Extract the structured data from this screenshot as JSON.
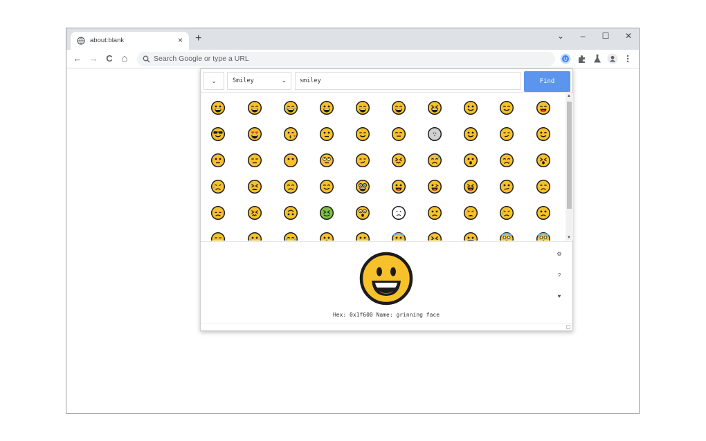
{
  "tab": {
    "title": "about:blank",
    "close": "×"
  },
  "new_tab": "+",
  "window": {
    "dropdown": "⌄",
    "minimize": "–",
    "maximize": "☐",
    "close": "✕"
  },
  "nav": {
    "back": "←",
    "forward": "→",
    "reload": "C",
    "home": "⌂"
  },
  "omnibox": {
    "placeholder": "Search Google or type a URL"
  },
  "popup": {
    "mode_label": "⌄",
    "category": "Smiley",
    "search_value": "smiley",
    "find_label": "Find",
    "emojis": [
      [
        "grinning",
        "grin-big",
        "joy",
        "smile-open",
        "smile",
        "sweat",
        "laughing",
        "slight",
        "blush",
        "yum"
      ],
      [
        "sunglasses",
        "heart-eyes",
        "kiss",
        "neutral",
        "squint",
        "smirk-closed",
        "small",
        "slight",
        "smirk",
        "wink"
      ],
      [
        "neutral",
        "expressionless",
        "no-mouth",
        "rolling-eyes",
        "smirk",
        "persevere",
        "sad-sweat",
        "hushed",
        "sleepy",
        "tired"
      ],
      [
        "disappointed",
        "weary",
        "sleepy",
        "relieved",
        "nerd",
        "tongue",
        "winky-tongue",
        "closed-tongue",
        "confused",
        "unamused"
      ],
      [
        "pensive",
        "confounded",
        "upside",
        "nauseated",
        "astonished",
        "frown-outline",
        "sad",
        "frown",
        "disappointed",
        "worried"
      ],
      [
        "triumph",
        "cry",
        "sob",
        "frown-open",
        "anguish",
        "fearful",
        "weary",
        "grimace",
        "scream",
        "scream"
      ]
    ],
    "preview": {
      "emoji": "grinning",
      "info": "Hex: 0x1f600 Name: grinning face"
    },
    "side_icons": [
      "⚙",
      "?",
      "♥"
    ],
    "colors": {
      "face": "#f7c12c",
      "outline": "#1c1c1c",
      "find": "#5b95ee"
    }
  }
}
